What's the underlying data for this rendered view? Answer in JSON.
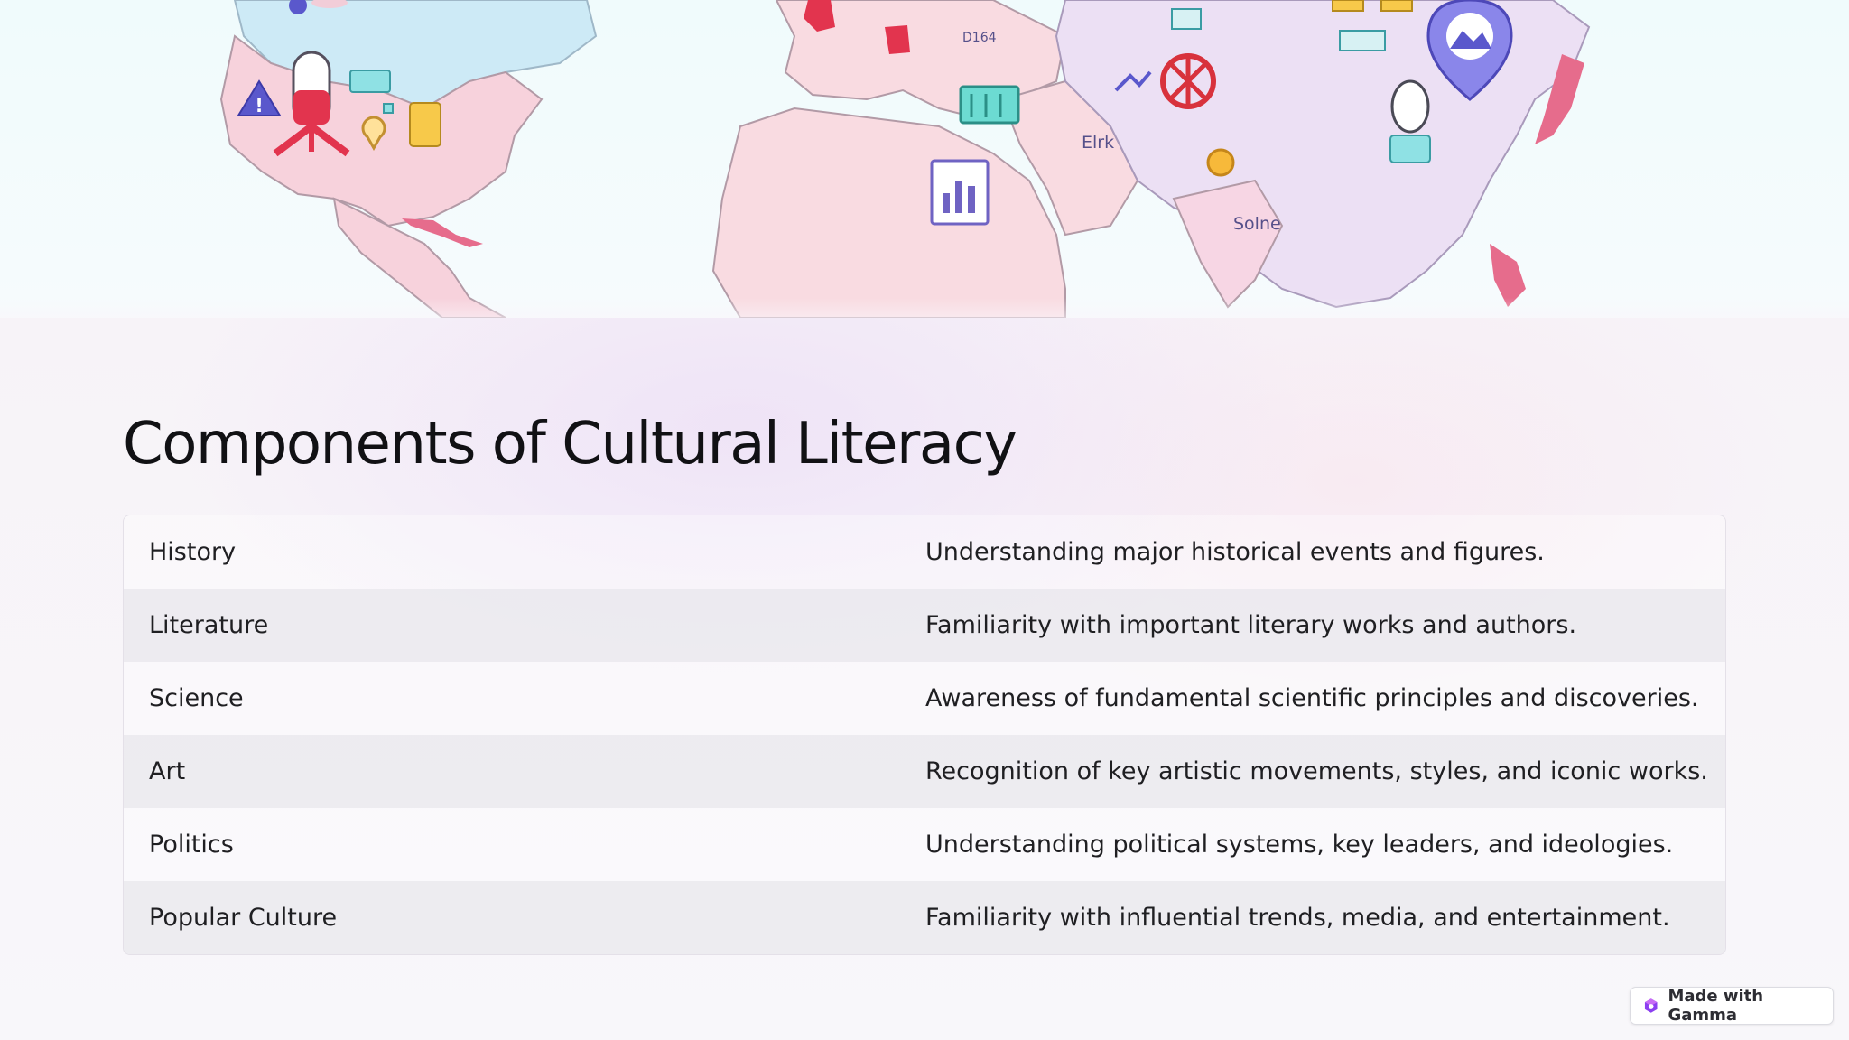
{
  "hero": {
    "map_labels": [
      "Elrk",
      "Solne",
      "D164"
    ],
    "colors": {
      "america": "#f7d2dc",
      "europe_africa": "#f9dbe1",
      "asia": "#ece0f4",
      "canada": "#cdeaf6",
      "ocean": "#f2fbfc"
    }
  },
  "slide": {
    "title": "Components of Cultural Literacy",
    "rows": [
      {
        "term": "History",
        "description": "Understanding major historical events and figures."
      },
      {
        "term": "Literature",
        "description": "Familiarity with important literary works and authors."
      },
      {
        "term": "Science",
        "description": "Awareness of fundamental scientific principles and discoveries."
      },
      {
        "term": "Art",
        "description": "Recognition of key artistic movements, styles, and iconic works."
      },
      {
        "term": "Politics",
        "description": "Understanding political systems, key leaders, and ideologies."
      },
      {
        "term": "Popular Culture",
        "description": "Familiarity with influential trends, media, and entertainment."
      }
    ]
  },
  "badge": {
    "label": "Made with Gamma",
    "icon": "gamma-logo-icon"
  }
}
